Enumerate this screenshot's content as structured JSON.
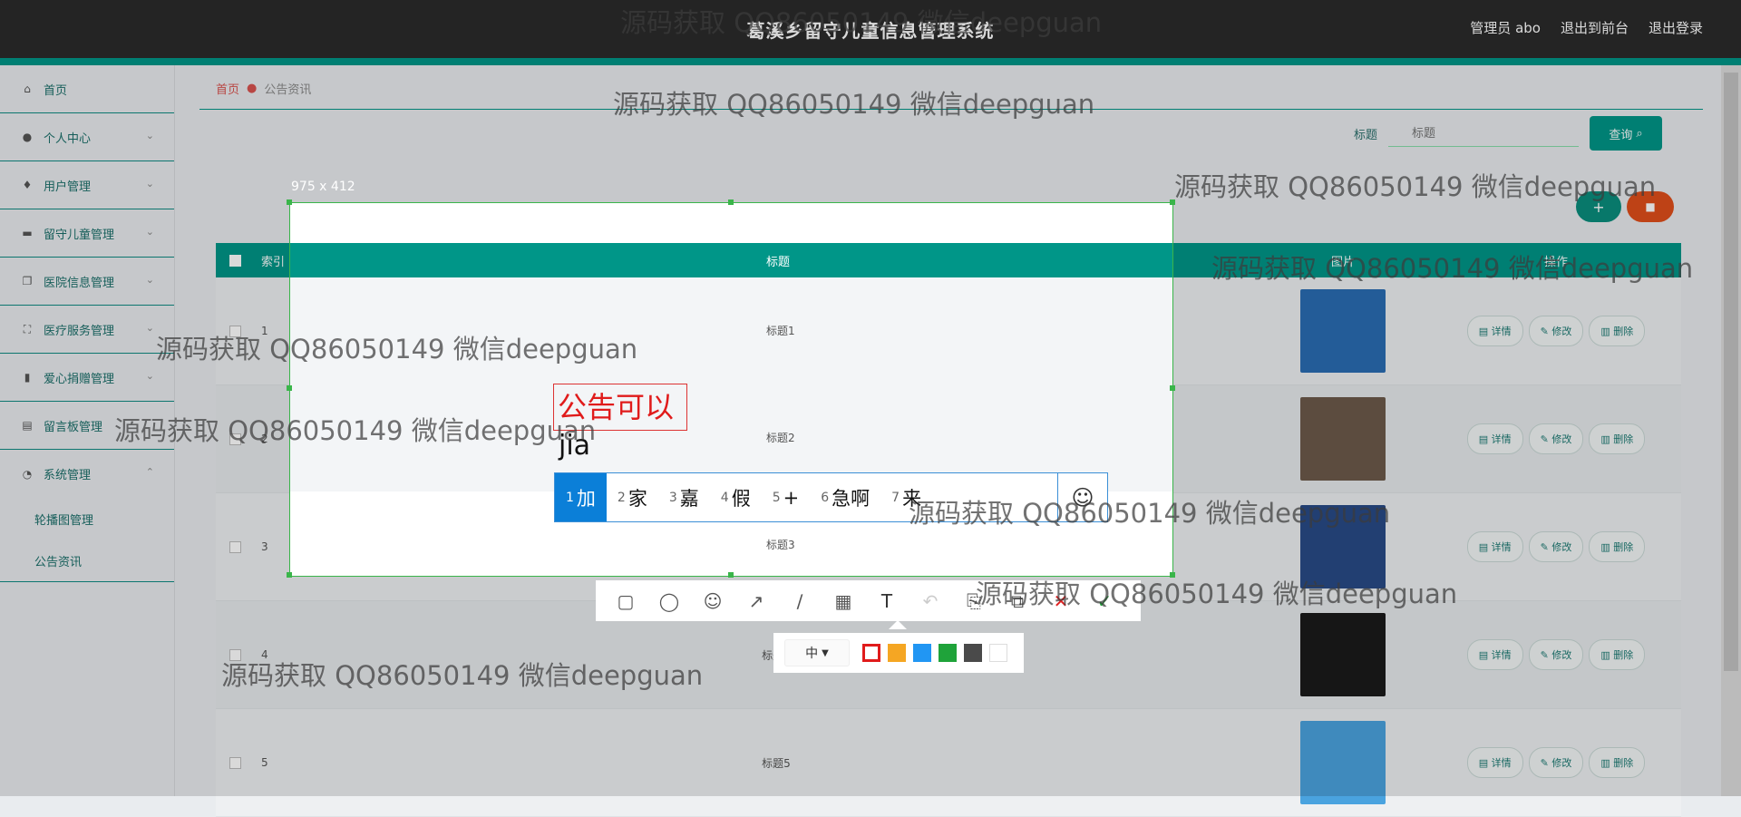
{
  "app": {
    "title": "葛溪乡留守儿童信息管理系统",
    "user_label": "管理员 abo",
    "front_label": "退出到前台",
    "logout_label": "退出登录"
  },
  "sidebar": {
    "items": [
      {
        "label": "首页",
        "icon": "home-icon"
      },
      {
        "label": "个人中心",
        "icon": "user-icon"
      },
      {
        "label": "用户管理",
        "icon": "mic-icon"
      },
      {
        "label": "留守儿童管理",
        "icon": "monitor-icon"
      },
      {
        "label": "医院信息管理",
        "icon": "copy-icon"
      },
      {
        "label": "医疗服务管理",
        "icon": "fullscreen-icon"
      },
      {
        "label": "爱心捐赠管理",
        "icon": "bar-chart-icon"
      },
      {
        "label": "留言板管理",
        "icon": "note-icon"
      },
      {
        "label": "系统管理",
        "icon": "gauge-icon"
      }
    ],
    "sub_items": [
      "轮播图管理",
      "公告资讯"
    ]
  },
  "breadcrumb": {
    "home": "首页",
    "current": "公告资讯"
  },
  "search": {
    "label": "标题",
    "placeholder": "标题",
    "button": "查询"
  },
  "actions": {
    "add": "+",
    "delete": "🗑"
  },
  "table": {
    "headers": {
      "index": "索引",
      "title": "标题",
      "image": "图片",
      "ops": "操作"
    },
    "rows": [
      {
        "index": "1",
        "title": "标题1"
      },
      {
        "index": "2",
        "title": "标题2"
      },
      {
        "index": "3",
        "title": "标题3"
      },
      {
        "index": "4",
        "title": "标题4"
      },
      {
        "index": "5",
        "title": "标题5"
      }
    ],
    "op_labels": {
      "detail": "详情",
      "edit": "修改",
      "delete": "删除"
    }
  },
  "screenshot_tool": {
    "size_label": "975 x 412",
    "typed_text": "公告可以",
    "ime_composition": "jia",
    "candidates": [
      {
        "n": "1",
        "text": "加"
      },
      {
        "n": "2",
        "text": "家"
      },
      {
        "n": "3",
        "text": "嘉"
      },
      {
        "n": "4",
        "text": "假"
      },
      {
        "n": "5",
        "text": "+"
      },
      {
        "n": "6",
        "text": "急啊"
      },
      {
        "n": "7",
        "text": "来"
      }
    ],
    "font_size": "中",
    "colors": [
      "#e01b1b",
      "#f5a623",
      "#2196f3",
      "#1fa33a",
      "#4a4a4a",
      "#ffffff"
    ]
  },
  "watermark": "源码获取 QQ86050149 微信deepguan"
}
